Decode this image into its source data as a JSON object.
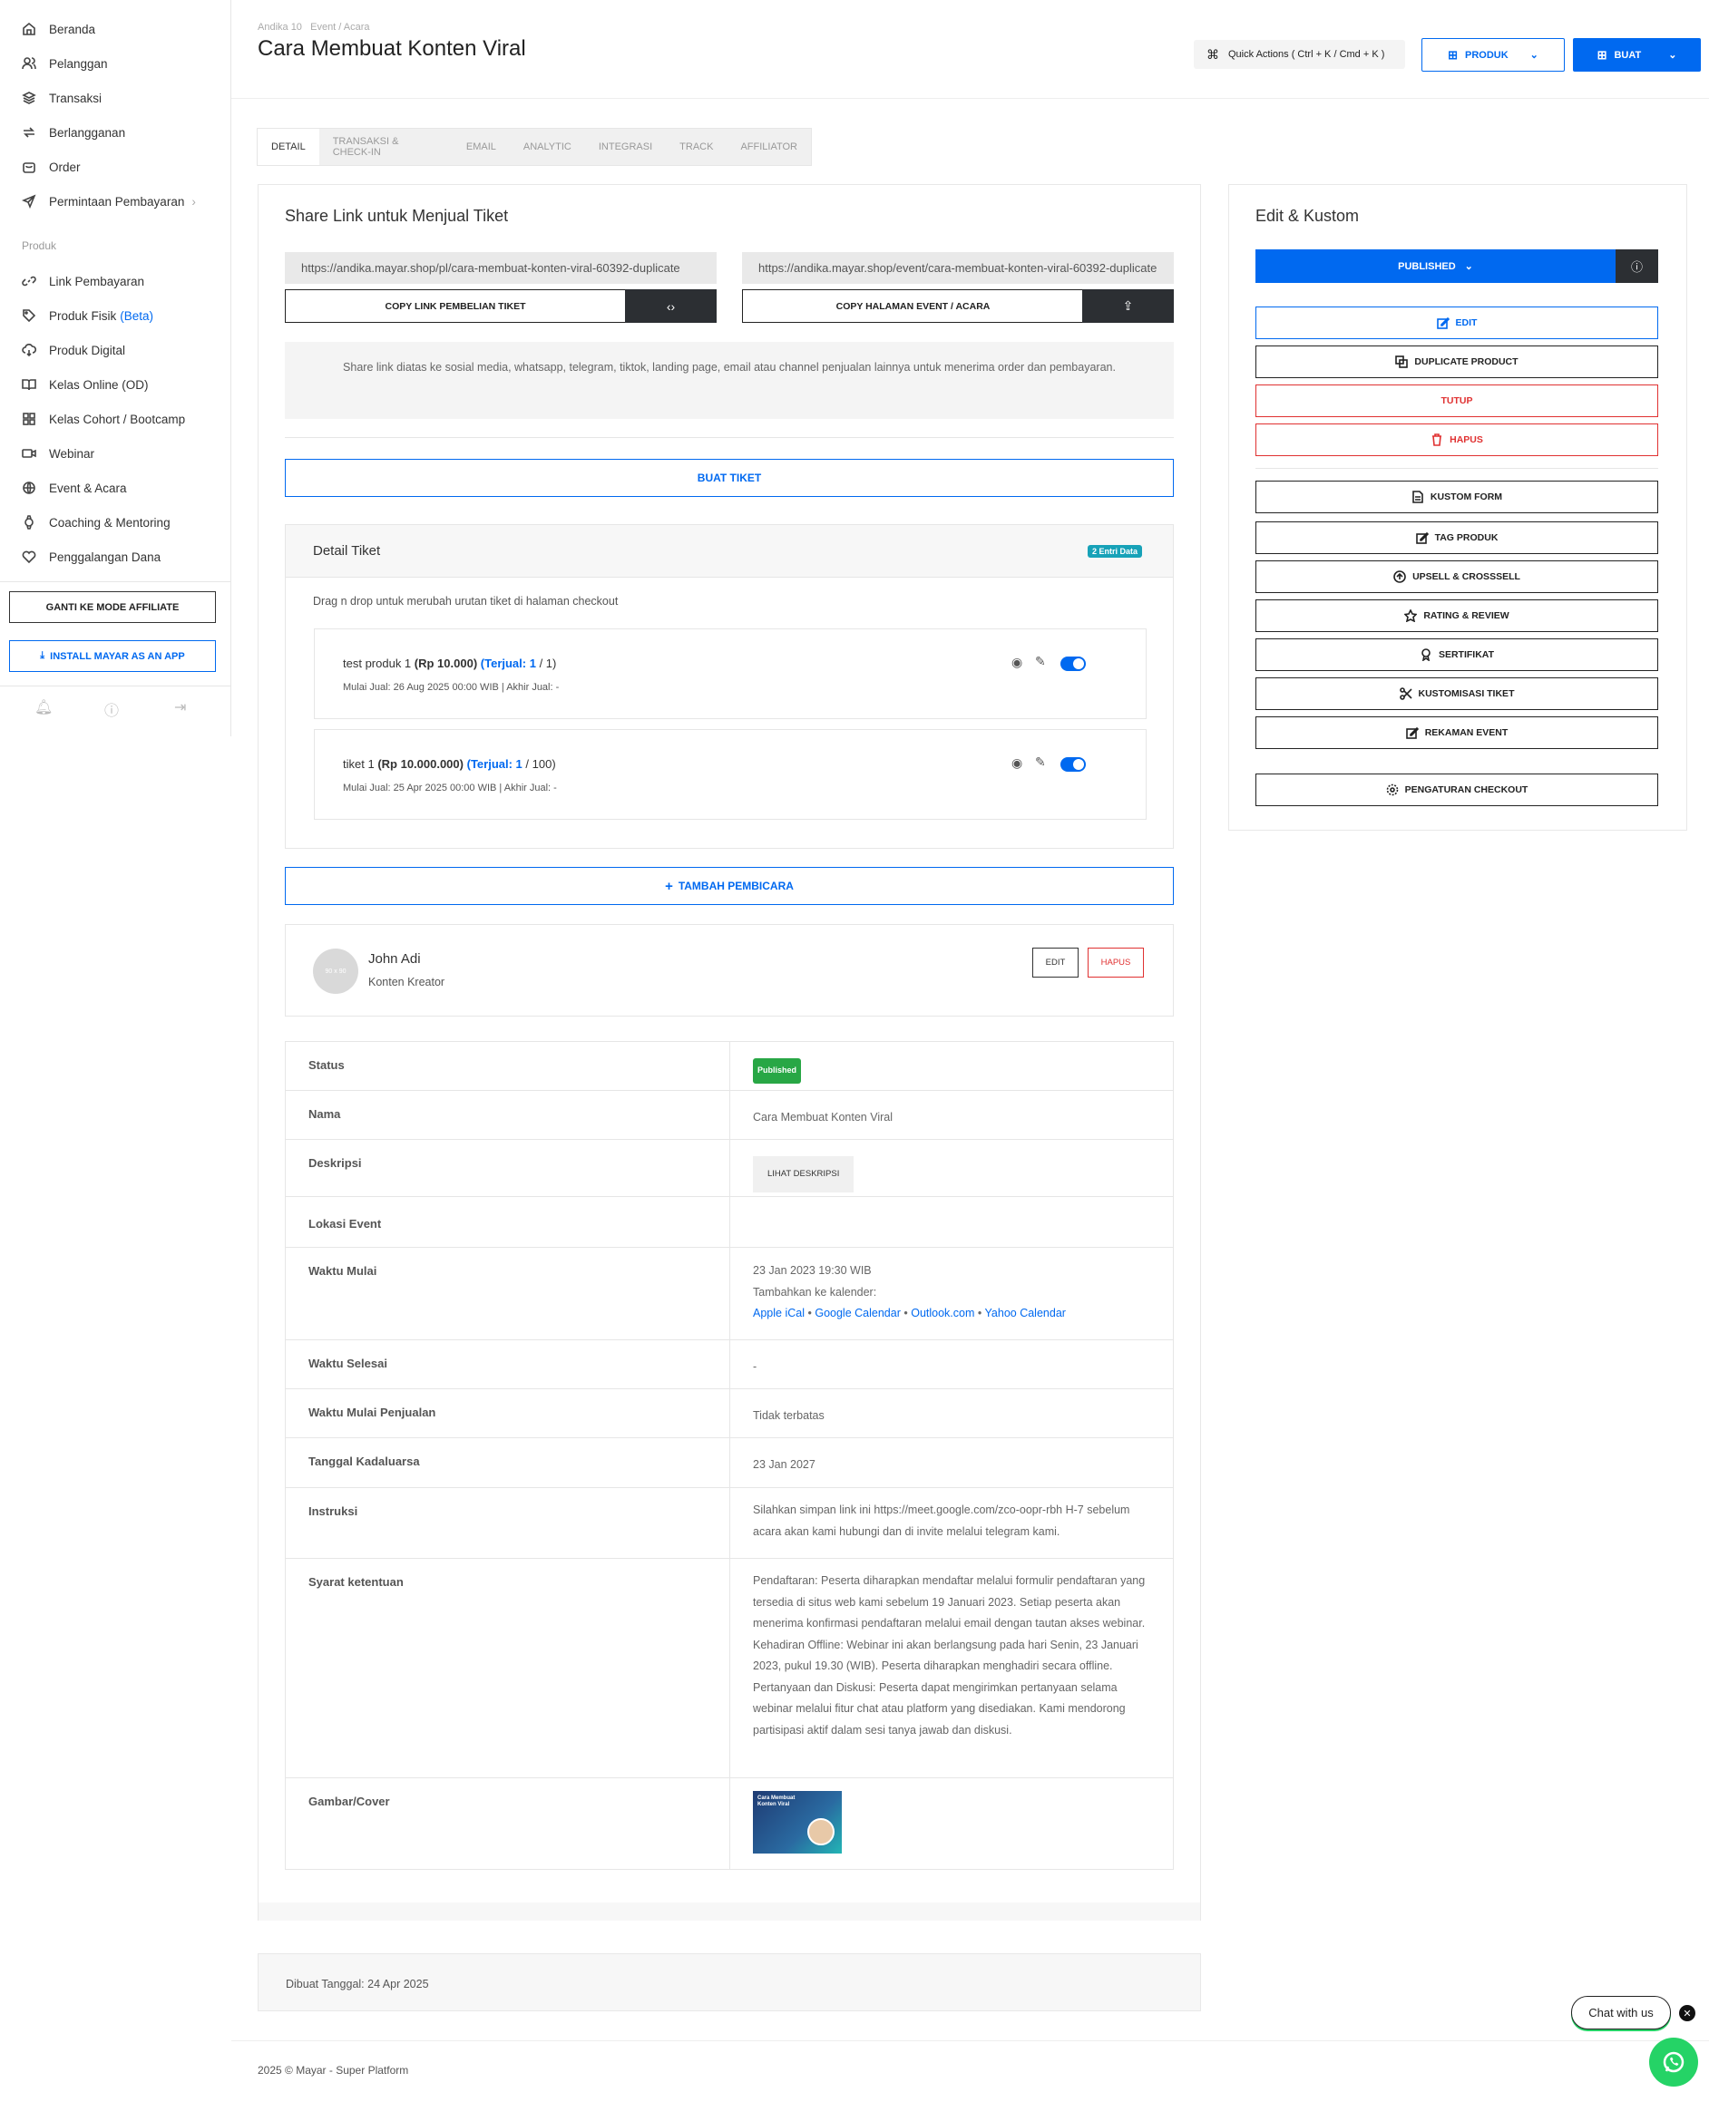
{
  "sidebar": {
    "items": [
      {
        "label": "Beranda",
        "icon": "home-icon"
      },
      {
        "label": "Pelanggan",
        "icon": "users-icon"
      },
      {
        "label": "Transaksi",
        "icon": "layers-icon"
      },
      {
        "label": "Berlangganan",
        "icon": "repeat-icon"
      },
      {
        "label": "Order",
        "icon": "bag-icon"
      },
      {
        "label": "Permintaan Pembayaran",
        "icon": "send-icon"
      }
    ],
    "section_label": "Produk",
    "product_items": [
      {
        "label": "Link Pembayaran",
        "icon": "link-icon"
      },
      {
        "label": "Produk Fisik",
        "badge": "(Beta)",
        "icon": "tag-icon"
      },
      {
        "label": "Produk Digital",
        "icon": "download-cloud-icon"
      },
      {
        "label": "Kelas Online (OD)",
        "icon": "book-icon"
      },
      {
        "label": "Kelas Cohort / Bootcamp",
        "icon": "grid-icon"
      },
      {
        "label": "Webinar",
        "icon": "video-icon"
      },
      {
        "label": "Event & Acara",
        "icon": "globe-icon"
      },
      {
        "label": "Coaching & Mentoring",
        "icon": "watch-icon"
      },
      {
        "label": "Penggalangan Dana",
        "icon": "heart-icon"
      }
    ],
    "affiliate_button": "GANTI KE MODE AFFILIATE",
    "install_button": "INSTALL MAYAR AS AN APP"
  },
  "header": {
    "breadcrumb_user": "Andika 10",
    "breadcrumb_section": "Event / Acara",
    "title": "Cara Membuat Konten Viral",
    "quick_actions": "Quick Actions ( Ctrl + K / Cmd + K )",
    "produk_button": "PRODUK",
    "buat_button": "BUAT"
  },
  "tabs": [
    "DETAIL",
    "TRANSAKSI & CHECK-IN",
    "EMAIL",
    "ANALYTIC",
    "INTEGRASI",
    "TRACK",
    "AFFILIATOR"
  ],
  "share": {
    "title": "Share Link untuk Menjual Tiket",
    "url_purchase": "https://andika.mayar.shop/pl/cara-membuat-konten-viral-60392-duplicate",
    "url_event": "https://andika.mayar.shop/event/cara-membuat-konten-viral-60392-duplicate",
    "copy_purchase": "COPY LINK PEMBELIAN TIKET",
    "copy_event": "COPY HALAMAN EVENT / ACARA",
    "info": "Share link diatas ke sosial media, whatsapp, telegram, tiktok, landing page, email atau channel penjualan lainnya untuk menerima order dan pembayaran."
  },
  "buat_tiket": "BUAT TIKET",
  "tickets": {
    "title": "Detail Tiket",
    "badge": "2 Entri Data",
    "hint": "Drag n drop untuk merubah urutan tiket di halaman checkout",
    "rows": [
      {
        "name": "test produk 1",
        "price": "(Rp 10.000)",
        "sold_label": "(Terjual: 1",
        "quota": "/ 1)",
        "meta": "Mulai Jual: 26 Aug 2025 00:00 WIB | Akhir Jual: -"
      },
      {
        "name": "tiket 1",
        "price": "(Rp 10.000.000)",
        "sold_label": "(Terjual: 1",
        "quota": "/ 100)",
        "meta": "Mulai Jual: 25 Apr 2025 00:00 WIB | Akhir Jual: -"
      }
    ]
  },
  "tambah_pembicara": "TAMBAH PEMBICARA",
  "speaker": {
    "avatar_text": "90 x 90",
    "name": "John Adi",
    "role": "Konten Kreator",
    "edit": "EDIT",
    "hapus": "HAPUS"
  },
  "details": {
    "status_label": "Status",
    "status_value": "Published",
    "nama_label": "Nama",
    "nama_value": "Cara Membuat Konten Viral",
    "deskripsi_label": "Deskripsi",
    "deskripsi_button": "LIHAT DESKRIPSI",
    "lokasi_label": "Lokasi Event",
    "waktu_mulai_label": "Waktu Mulai",
    "waktu_mulai_value": "23 Jan 2023 19:30 WIB",
    "calendar_label": "Tambahkan ke kalender:",
    "cal_apple": "Apple iCal",
    "cal_google": "Google Calendar",
    "cal_outlook": "Outlook.com",
    "cal_yahoo": "Yahoo Calendar",
    "cal_sep": "•",
    "waktu_selesai_label": "Waktu Selesai",
    "waktu_selesai_value": "-",
    "mulai_penjualan_label": "Waktu Mulai Penjualan",
    "mulai_penjualan_value": "Tidak terbatas",
    "kadaluarsa_label": "Tanggal Kadaluarsa",
    "kadaluarsa_value": "23 Jan 2027",
    "instruksi_label": "Instruksi",
    "instruksi_value": "Silahkan simpan link ini https://meet.google.com/zco-oopr-rbh H-7 sebelum acara akan kami hubungi dan di invite melalui telegram kami.",
    "syarat_label": "Syarat ketentuan",
    "syarat_value": "Pendaftaran: Peserta diharapkan mendaftar melalui formulir pendaftaran yang tersedia di situs web kami sebelum 19 Januari 2023. Setiap peserta akan menerima konfirmasi pendaftaran melalui email dengan tautan akses webinar. Kehadiran Offline: Webinar ini akan berlangsung pada hari Senin, 23 Januari 2023, pukul 19.30 (WIB). Peserta diharapkan menghadiri secara offline. Pertanyaan dan Diskusi: Peserta dapat mengirimkan pertanyaan selama webinar melalui fitur chat atau platform yang disediakan. Kami mendorong partisipasi aktif dalam sesi tanya jawab dan diskusi.",
    "cover_label": "Gambar/Cover",
    "cover_title": "Cara Membuat Konten Viral"
  },
  "created": "Dibuat Tanggal: 24 Apr 2025",
  "side": {
    "title": "Edit & Kustom",
    "published": "PUBLISHED",
    "buttons": {
      "edit": "EDIT",
      "duplicate": "DUPLICATE PRODUCT",
      "tutup": "TUTUP",
      "hapus": "HAPUS",
      "kustom_form": "KUSTOM FORM",
      "tag_produk": "TAG PRODUK",
      "upsell": "UPSELL & CROSSSELL",
      "rating": "RATING & REVIEW",
      "sertifikat": "SERTIFIKAT",
      "kustomisasi": "KUSTOMISASI TIKET",
      "rekaman": "REKAMAN EVENT",
      "checkout": "PENGATURAN CHECKOUT"
    }
  },
  "footer": "2025 © Mayar - Super Platform",
  "chat": "Chat with us",
  "colors": {
    "primary": "#0069f0",
    "danger": "#e03131",
    "success": "#28a745",
    "teal": "#17a2b8",
    "whatsapp": "#25d366"
  }
}
